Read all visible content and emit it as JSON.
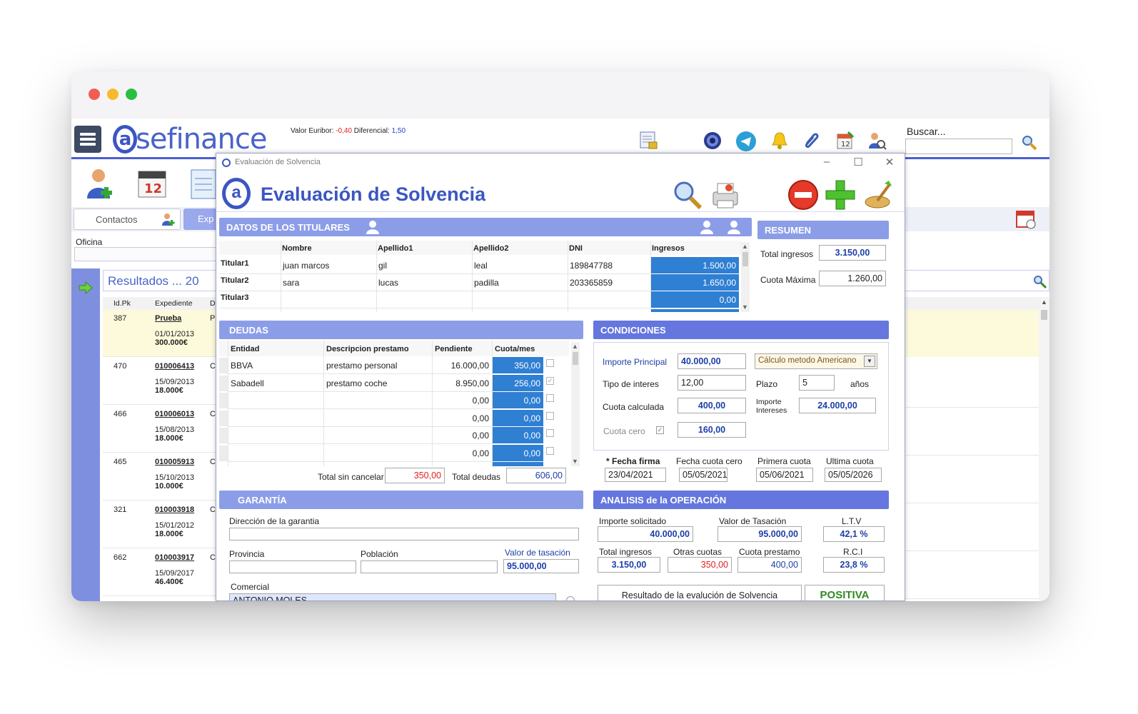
{
  "app": {
    "logo_text": "sefinance",
    "logo_mark": "a",
    "euribor_label": "Valor Euribor:",
    "euribor_value": "-0,40",
    "diferencial_label": "Diferencial:",
    "diferencial_value": "1,50",
    "search_label": "Buscar...",
    "search_placeholder": "",
    "tabs": [
      {
        "label": "Contactos"
      },
      {
        "label": "Exp"
      }
    ],
    "oficina_label": "Oficina",
    "oficina_value": "",
    "results_title": "Resultados ... 20",
    "results_columns": [
      "Id.Pk",
      "Expediente",
      "D"
    ],
    "results_rows": [
      {
        "id": "387",
        "expediente": "Prueba",
        "date": "01/01/2013",
        "amount": "300.000€",
        "c": "P",
        "highlight": true
      },
      {
        "id": "470",
        "expediente": "010006413",
        "date": "15/09/2013",
        "amount": "18.000€",
        "c": "C"
      },
      {
        "id": "466",
        "expediente": "010006013",
        "date": "15/08/2013",
        "amount": "18.000€",
        "c": "C"
      },
      {
        "id": "465",
        "expediente": "010005913",
        "date": "15/10/2013",
        "amount": "10.000€",
        "c": "C"
      },
      {
        "id": "321",
        "expediente": "010003918",
        "date": "15/01/2012",
        "amount": "18.000€",
        "c": "C"
      },
      {
        "id": "662",
        "expediente": "010003917",
        "date": "15/09/2017",
        "amount": "46.400€",
        "c": "C"
      }
    ]
  },
  "dialog": {
    "window_title": "Evaluación de Solvencia",
    "heading": "Evaluación de Solvencia",
    "logo_mark": "a",
    "titulares": {
      "section_title": "DATOS DE LOS TITULARES",
      "columns": [
        "Nombre",
        "Apellido1",
        "Apellido2",
        "DNI",
        "Ingresos"
      ],
      "rows": [
        {
          "label": "Titular1",
          "nombre": "juan marcos",
          "apellido1": "gil",
          "apellido2": "leal",
          "dni": "189847788",
          "ingresos": "1.500,00"
        },
        {
          "label": "Titular2",
          "nombre": "sara",
          "apellido1": "lucas",
          "apellido2": "padilla",
          "dni": "203365859",
          "ingresos": "1.650,00"
        },
        {
          "label": "Titular3",
          "nombre": "",
          "apellido1": "",
          "apellido2": "",
          "dni": "",
          "ingresos": "0,00"
        }
      ]
    },
    "resumen": {
      "section_title": "RESUMEN",
      "total_ingresos_label": "Total ingresos",
      "total_ingresos": "3.150,00",
      "cuota_maxima_label": "Cuota Máxima",
      "cuota_maxima": "1.260,00"
    },
    "deudas": {
      "section_title": "DEUDAS",
      "columns": [
        "Entidad",
        "Descripcion prestamo",
        "Pendiente",
        "Cuota/mes"
      ],
      "rows": [
        {
          "entidad": "BBVA",
          "descripcion": "prestamo personal",
          "pendiente": "16.000,00",
          "cuota": "350,00",
          "checked": false
        },
        {
          "entidad": "Sabadell",
          "descripcion": "prestamo coche",
          "pendiente": "8.950,00",
          "cuota": "256,00",
          "checked": true
        },
        {
          "entidad": "",
          "descripcion": "",
          "pendiente": "0,00",
          "cuota": "0,00",
          "checked": false
        },
        {
          "entidad": "",
          "descripcion": "",
          "pendiente": "0,00",
          "cuota": "0,00",
          "checked": false
        },
        {
          "entidad": "",
          "descripcion": "",
          "pendiente": "0,00",
          "cuota": "0,00",
          "checked": false
        },
        {
          "entidad": "",
          "descripcion": "",
          "pendiente": "0,00",
          "cuota": "0,00",
          "checked": false
        }
      ],
      "total_sin_cancelar_label": "Total sin cancelar",
      "total_sin_cancelar": "350,00",
      "total_deudas_label": "Total deudas",
      "total_deudas": "606,00"
    },
    "condiciones": {
      "section_title": "CONDICIONES",
      "importe_principal_label": "Importe Principal",
      "importe_principal": "40.000,00",
      "metodo": "Cálculo metodo Americano",
      "tipo_interes_label": "Tipo de interes",
      "tipo_interes": "12,00",
      "plazo_label": "Plazo",
      "plazo": "5",
      "plazo_unit": "años",
      "cuota_calculada_label": "Cuota calculada",
      "cuota_calculada": "400,00",
      "importe_intereses_label_1": "Importe",
      "importe_intereses_label_2": "Intereses",
      "importe_intereses": "24.000,00",
      "cuota_cero_label": "Cuota cero",
      "cuota_cero_checked": true,
      "cuota_cero": "160,00",
      "fecha_firma_label": "* Fecha firma",
      "fecha_firma": "23/04/2021",
      "fecha_cuota_cero_label": "Fecha cuota cero",
      "fecha_cuota_cero": "05/05/2021",
      "primera_cuota_label": "Primera cuota",
      "primera_cuota": "05/06/2021",
      "ultima_cuota_label": "Ultima cuota",
      "ultima_cuota": "05/05/2026"
    },
    "garantia": {
      "section_title": "GARANTÍA",
      "direccion_label": "Dirección de la garantia",
      "direccion": "",
      "provincia_label": "Provincia",
      "provincia": "",
      "poblacion_label": "Población",
      "poblacion": "",
      "valor_tasacion_label": "Valor de tasación",
      "valor_tasacion": "95.000,00",
      "comercial_label": "Comercial",
      "comercial": "ANTONIO MOLES"
    },
    "analisis": {
      "section_title": "ANALISIS de la OPERACIÓN",
      "importe_solicitado_label": "Importe solicitado",
      "importe_solicitado": "40.000,00",
      "valor_tasacion_label": "Valor de Tasación",
      "valor_tasacion": "95.000,00",
      "ltv_label": "L.T.V",
      "ltv": "42,1 %",
      "total_ingresos_label": "Total ingresos",
      "total_ingresos": "3.150,00",
      "otras_cuotas_label": "Otras cuotas",
      "otras_cuotas": "350,00",
      "cuota_prestamo_label": "Cuota prestamo",
      "cuota_prestamo": "400,00",
      "rci_label": "R.C.I",
      "rci": "23,8 %",
      "resultado_label": "Resultado de la evalución de Solvencia",
      "resultado": "POSITIVA"
    }
  },
  "colors": {
    "accent": "#3b56c2",
    "section_bar": "#8c9de8",
    "section_bar_dark": "#6576df",
    "blue_cell": "#2f7fd3",
    "negative": "#e02020",
    "positive": "#2e8b1e"
  }
}
